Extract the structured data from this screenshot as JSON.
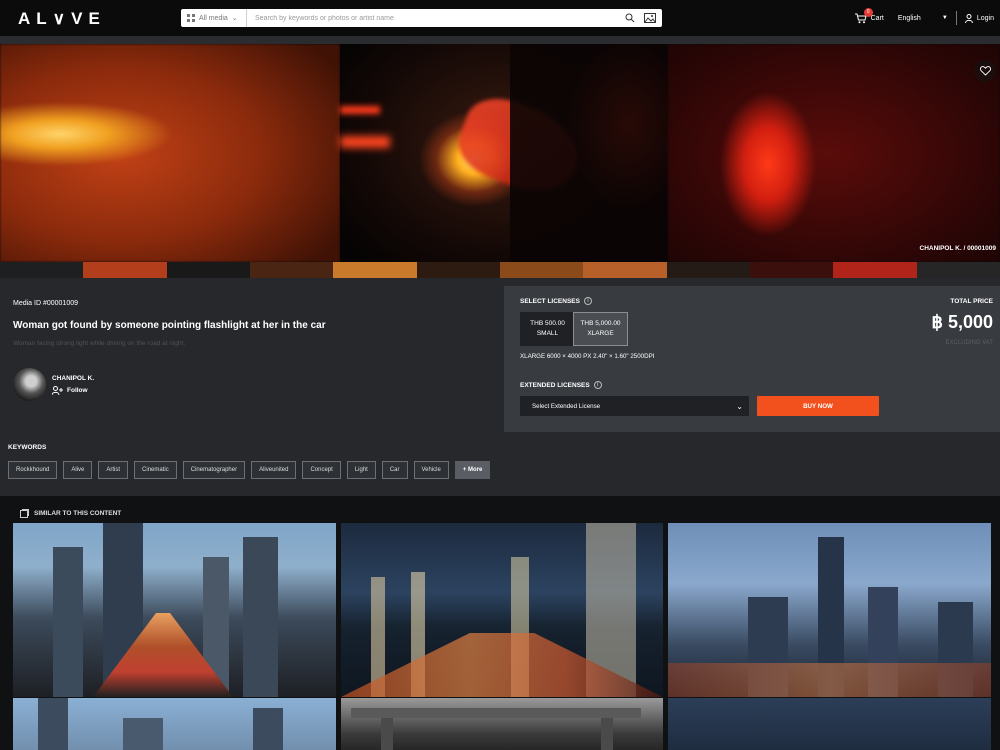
{
  "header": {
    "logo": "AL∨VE",
    "search_category": "All media",
    "search_placeholder": "Search by keywords or photos or artist name",
    "cart_label": "Cart",
    "cart_count": "0",
    "language": "English",
    "login_label": "Login"
  },
  "hero": {
    "credit": "CHANIPOL K. / 00001009"
  },
  "palette": [
    "#1e1f21",
    "#b23e1c",
    "#191919",
    "#4a2514",
    "#c97a2a",
    "#2d1a10",
    "#8a4a1a",
    "#b8602a",
    "#241a16",
    "#3a0f0c",
    "#b0241a",
    "#262626"
  ],
  "media": {
    "id_label": "Media ID #00001009",
    "title": "Woman got found by someone pointing flashlight at her in the car",
    "description": "Woman facing strong light while driving on the road at night.",
    "artist": "CHANIPOL K.",
    "follow_label": "Follow"
  },
  "licenses": {
    "section_label": "SELECT LICENSES",
    "options": [
      {
        "price": "THB 500.00",
        "size": "SMALL",
        "selected": false
      },
      {
        "price": "THB 5,000.00",
        "size": "XLARGE",
        "selected": true
      }
    ],
    "dimensions": "XLARGE 6000 × 4000 PX 2.40\" × 1.60\" 2500DPI",
    "extended_label": "EXTENDED LICENSES",
    "extended_select": "Select Extended License",
    "buy_label": "BUY NOW",
    "total_label": "TOTAL PRICE",
    "total_price": "฿ 5,000",
    "vat_note": "EXCLUDING VAT",
    "buy_color": "#f2501c"
  },
  "keywords": {
    "title": "KEYWORDS",
    "items": [
      "Rockkhound",
      "Alive",
      "Artist",
      "Cinematic",
      "Cinematographer",
      "Aliveunited",
      "Concept",
      "Light",
      "Car",
      "Vehicle"
    ],
    "more_label": "+ More"
  },
  "similar": {
    "title": "SIMILAR TO THIS CONTENT"
  }
}
